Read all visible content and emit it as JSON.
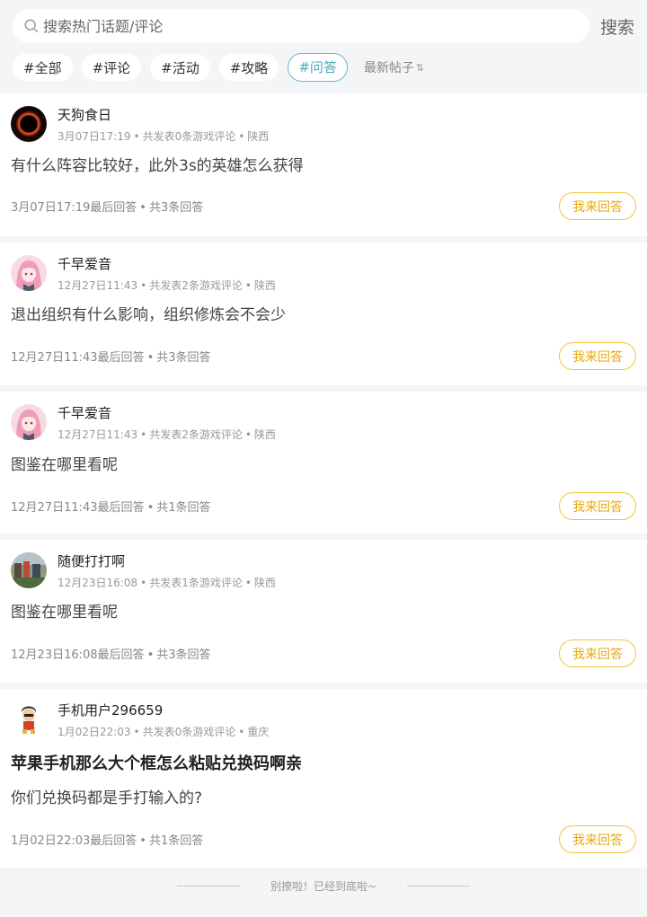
{
  "search": {
    "placeholder": "搜索热门话题/评论",
    "button": "搜索"
  },
  "tags": [
    "#全部",
    "#评论",
    "#活动",
    "#攻略",
    "#问答"
  ],
  "active_tag_index": 4,
  "sort": {
    "label": "最新帖子",
    "icon": "⇅"
  },
  "answer_label": "我来回答",
  "posts": [
    {
      "user": "天狗食日",
      "time": "3月07日17:19",
      "count_text": "共发表0条游戏评论",
      "location": "陕西",
      "title": "",
      "content": "有什么阵容比较好，此外3s的英雄怎么获得",
      "last_reply": "3月07日17:19最后回答",
      "reply_count": "共3条回答"
    },
    {
      "user": "千早爱音",
      "time": "12月27日11:43",
      "count_text": "共发表2条游戏评论",
      "location": "陕西",
      "title": "",
      "content": "退出组织有什么影响，组织修炼会不会少",
      "last_reply": "12月27日11:43最后回答",
      "reply_count": "共3条回答"
    },
    {
      "user": "千早爱音",
      "time": "12月27日11:43",
      "count_text": "共发表2条游戏评论",
      "location": "陕西",
      "title": "",
      "content": "图鉴在哪里看呢",
      "last_reply": "12月27日11:43最后回答",
      "reply_count": "共1条回答"
    },
    {
      "user": "随便打打啊",
      "time": "12月23日16:08",
      "count_text": "共发表1条游戏评论",
      "location": "陕西",
      "title": "",
      "content": "图鉴在哪里看呢",
      "last_reply": "12月23日16:08最后回答",
      "reply_count": "共3条回答"
    },
    {
      "user": "手机用户296659",
      "time": "1月02日22:03",
      "count_text": "共发表0条游戏评论",
      "location": "重庆",
      "title": "苹果手机那么大个框怎么粘贴兑换码啊亲",
      "content": "你们兑换码都是手打输入的?",
      "last_reply": "1月02日22:03最后回答",
      "reply_count": "共1条回答"
    }
  ],
  "footer": "别撩啦！已经到底啦~"
}
